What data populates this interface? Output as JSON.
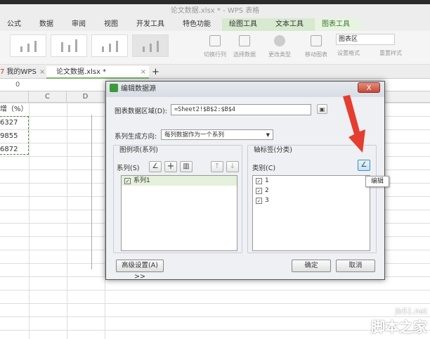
{
  "window": {
    "title": "论文数据.xlsx * - WPS 表格"
  },
  "menu": [
    "公式",
    "数据",
    "审阅",
    "视图",
    "开发工具",
    "特色功能",
    "绘图工具",
    "文本工具",
    "图表工具"
  ],
  "ribbon": {
    "buttons": [
      "切换行列",
      "选择数据",
      "更改类型",
      "移动图表"
    ],
    "element_select": "图表区",
    "set_format": "设置格式",
    "reset_format": "重置样式"
  },
  "doc_tabs": {
    "home": "我的WPS",
    "file": "论文数据.xlsx *",
    "close": "×",
    "add": "+"
  },
  "formula_bar": {
    "value": "0"
  },
  "columns": [
    "C",
    "D"
  ],
  "cells": [
    "增（%）",
    "6327",
    "9855",
    "6872"
  ],
  "dialog": {
    "title": "编辑数据源",
    "close": "X",
    "range_label": "图表数据区域(D):",
    "range_value": "=Sheet2!$B$2:$B$4",
    "direction_label": "系列生成方向:",
    "direction_value": "每列数据作为一个系列",
    "legend_group": "图例项(系列)",
    "series_label": "系列(S)",
    "series": [
      {
        "name": "系列1",
        "checked": true
      }
    ],
    "axis_group": "轴标签(分类)",
    "category_label": "类别(C)",
    "categories": [
      {
        "name": "1",
        "checked": true
      },
      {
        "name": "2",
        "checked": true
      },
      {
        "name": "3",
        "checked": true
      }
    ],
    "advanced": "高级设置(A) >>",
    "ok": "确定",
    "cancel": "取消"
  },
  "tooltip": "编辑",
  "watermark": {
    "site": "jb51.net",
    "name": "脚本之家"
  },
  "colors": {
    "accent": "#d7e9cf",
    "arrow": "#e53d2f",
    "close": "#c24a38"
  }
}
